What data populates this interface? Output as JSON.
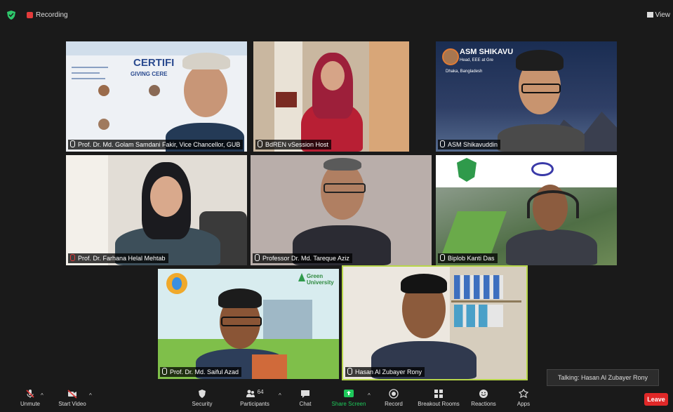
{
  "topbar": {
    "recording_label": "Recording",
    "view_label": "View"
  },
  "tiles": [
    {
      "name": "Prof. Dr. Md. Golam Samdani Fakir, Vice Chancellor, GUB",
      "bg": "#e9eef4"
    },
    {
      "name": "BdREN vSession Host",
      "bg": "#c7b39a"
    },
    {
      "name": "ASM Shikavuddin",
      "bg": "#20304f"
    },
    {
      "name": "Prof. Dr. Farhana Helal Mehtab",
      "bg": "#dcd6d0"
    },
    {
      "name": "Professor Dr. Md. Tareque Aziz",
      "bg": "#b6aaa6"
    },
    {
      "name": "Biplob Kanti Das",
      "bg": "#6b8a5a"
    },
    {
      "name": "Prof. Dr. Md. Saiful Azad",
      "bg": "#cfe3e8"
    },
    {
      "name": "Hasan Al Zubayer Rony",
      "bg": "#e8e3dc"
    }
  ],
  "backgrounds": {
    "certificate_text": "CERTIFI",
    "certificate_sub": "GIVING CERE",
    "asm_banner": "ASM SHIKAVU",
    "asm_role": "Head, EEE at Gre",
    "asm_loc": "Dhaka, Bangladesh",
    "green_univ": "Green University"
  },
  "talking": "Talking: Hasan Al Zubayer Rony",
  "toolbar": {
    "unmute": "Unmute",
    "start_video": "Start Video",
    "security": "Security",
    "participants": "Participants",
    "participants_count": "64",
    "chat": "Chat",
    "share_screen": "Share Screen",
    "record": "Record",
    "breakout": "Breakout Rooms",
    "reactions": "Reactions",
    "apps": "Apps",
    "leave": "Leave"
  },
  "colors": {
    "active_speaker": "#b7d64a",
    "share_green": "#1ec95b",
    "leave_red": "#e02828"
  }
}
